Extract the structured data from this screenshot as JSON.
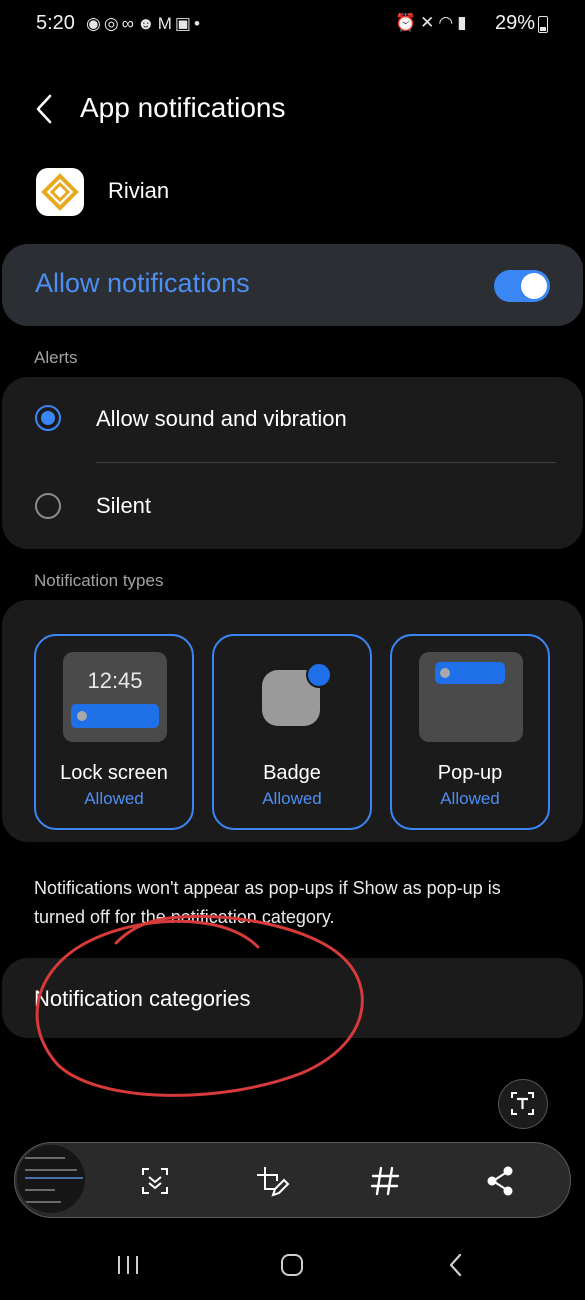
{
  "status_bar": {
    "time": "5:20",
    "notification_icons": [
      "messenger-icon",
      "whatsapp-icon",
      "voicemail-icon",
      "reddit-icon",
      "gmail-icon",
      "outlook-icon",
      "dot-icon"
    ],
    "system_icons": [
      "alarm-icon",
      "mute-icon",
      "wifi-icon",
      "signal-icon"
    ],
    "battery": "29%"
  },
  "header": {
    "title": "App notifications"
  },
  "app": {
    "name": "Rivian"
  },
  "allow": {
    "label": "Allow notifications",
    "enabled": true
  },
  "alerts": {
    "section_label": "Alerts",
    "options": [
      {
        "label": "Allow sound and vibration",
        "selected": true
      },
      {
        "label": "Silent",
        "selected": false
      }
    ]
  },
  "types": {
    "section_label": "Notification types",
    "items": [
      {
        "title": "Lock screen",
        "status": "Allowed",
        "preview_time": "12:45"
      },
      {
        "title": "Badge",
        "status": "Allowed"
      },
      {
        "title": "Pop-up",
        "status": "Allowed"
      }
    ]
  },
  "info_text": "Notifications won't appear as pop-ups if Show as pop-up is turned off for the notification category.",
  "categories": {
    "label": "Notification categories"
  },
  "toolbar": {
    "tools": [
      "scroll-capture-icon",
      "edit-icon",
      "tag-icon",
      "share-icon"
    ]
  },
  "colors": {
    "accent": "#3b86f5",
    "accent_text": "#4d8ef4",
    "background": "#000000",
    "card": "#1b1b1b",
    "annotation": "#d63a3a"
  }
}
